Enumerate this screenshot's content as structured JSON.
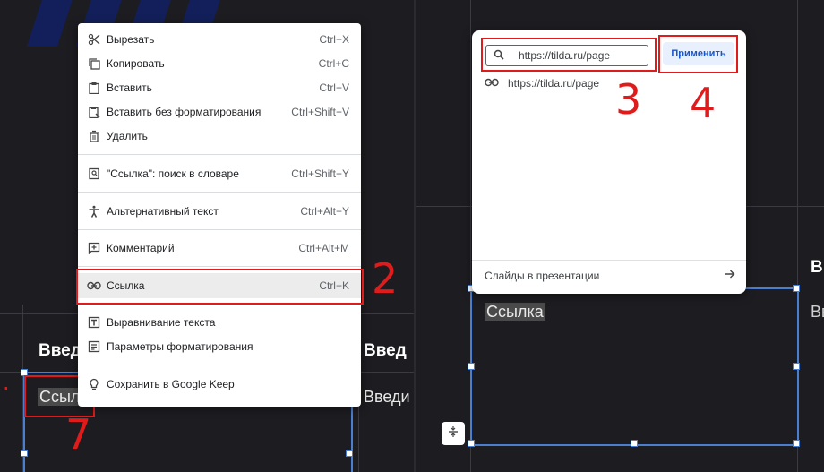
{
  "left": {
    "heading": "Введ",
    "heading_right": "Введ",
    "body_text": "Ссылка",
    "body_text_right": "Введи",
    "context_menu": {
      "items": [
        {
          "icon": "scissors-icon",
          "label": "Вырезать",
          "shortcut": "Ctrl+X"
        },
        {
          "icon": "copy-icon",
          "label": "Копировать",
          "shortcut": "Ctrl+C"
        },
        {
          "icon": "clipboard-icon",
          "label": "Вставить",
          "shortcut": "Ctrl+V"
        },
        {
          "icon": "paste-plain-icon",
          "label": "Вставить без форматирования",
          "shortcut": "Ctrl+Shift+V"
        },
        {
          "icon": "trash-icon",
          "label": "Удалить",
          "shortcut": ""
        },
        {
          "icon": "dictionary-icon",
          "label": "\"Ссылка\": поиск в словаре",
          "shortcut": "Ctrl+Shift+Y"
        },
        {
          "icon": "accessibility-icon",
          "label": "Альтернативный текст",
          "shortcut": "Ctrl+Alt+Y"
        },
        {
          "icon": "comment-add-icon",
          "label": "Комментарий",
          "shortcut": "Ctrl+Alt+M"
        },
        {
          "icon": "link-icon",
          "label": "Ссылка",
          "shortcut": "Ctrl+K"
        },
        {
          "icon": "text-align-icon",
          "label": "Выравнивание текста",
          "shortcut": ""
        },
        {
          "icon": "format-options-icon",
          "label": "Параметры форматирования",
          "shortcut": ""
        },
        {
          "icon": "keep-bulb-icon",
          "label": "Сохранить в Google Keep",
          "shortcut": ""
        }
      ]
    },
    "annotations": {
      "one": "7",
      "two": "2"
    }
  },
  "right": {
    "heading": "Вв",
    "body_text_right": "Вв",
    "body_text": "Ссылка",
    "link_popup": {
      "input_value": "https://tilda.ru/page",
      "apply_label": "Применить",
      "suggestion": "https://tilda.ru/page",
      "footer_label": "Слайды в презентации"
    },
    "annotations": {
      "three": "3",
      "four": "4"
    }
  },
  "colors": {
    "annotation": "#e01b1b",
    "selection": "#4a7fd0",
    "apply_button_bg": "#e8f0fe"
  }
}
